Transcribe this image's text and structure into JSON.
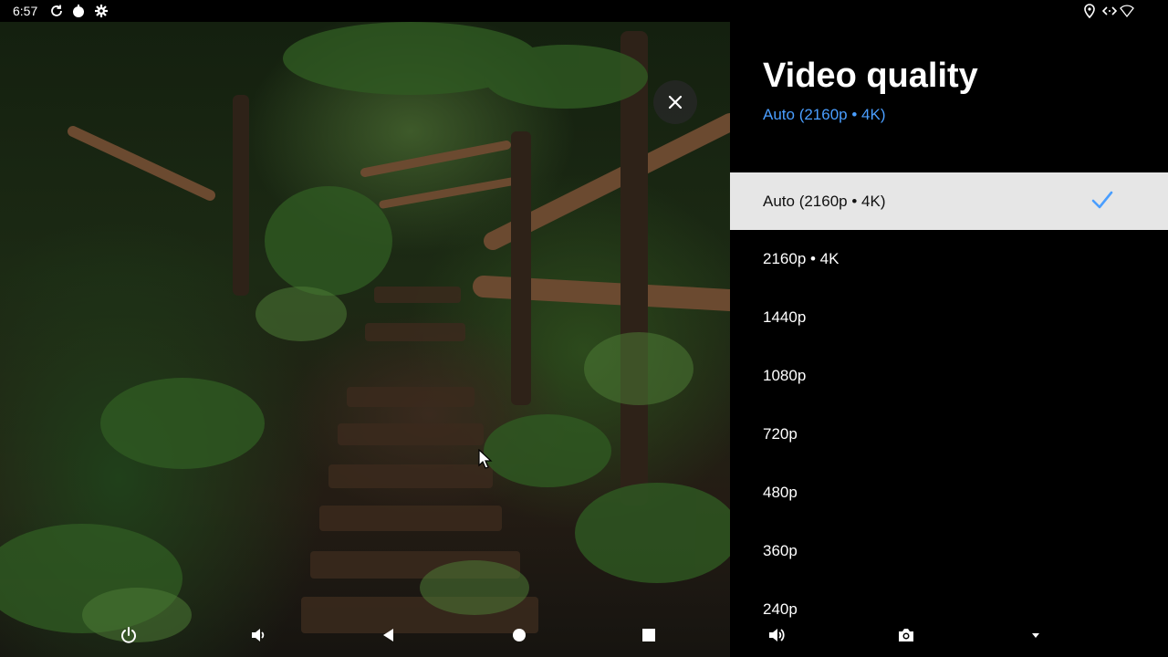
{
  "status_bar": {
    "time": "6:57",
    "left_icons": [
      "refresh-icon",
      "power-apple-icon",
      "settings-gear-icon"
    ],
    "right_icons": [
      "location-icon",
      "code-arrows-icon",
      "wifi-icon"
    ]
  },
  "video": {
    "close_icon": "close-icon"
  },
  "panel": {
    "title": "Video quality",
    "current": "Auto (2160p • 4K)",
    "options": [
      {
        "label": "Auto (2160p • 4K)",
        "selected": true
      },
      {
        "label": "2160p • 4K",
        "selected": false
      },
      {
        "label": "1440p",
        "selected": false
      },
      {
        "label": "1080p",
        "selected": false
      },
      {
        "label": "720p",
        "selected": false
      },
      {
        "label": "480p",
        "selected": false
      },
      {
        "label": "360p",
        "selected": false
      },
      {
        "label": "240p",
        "selected": false
      }
    ]
  },
  "nav": {
    "icons": [
      "power-icon",
      "volume-down-icon",
      "back-icon",
      "home-icon",
      "recents-icon",
      "volume-up-icon",
      "camera-icon",
      "dropdown-icon"
    ]
  },
  "colors": {
    "accent": "#4a9eff",
    "selected_bg": "#e6e6e6"
  }
}
